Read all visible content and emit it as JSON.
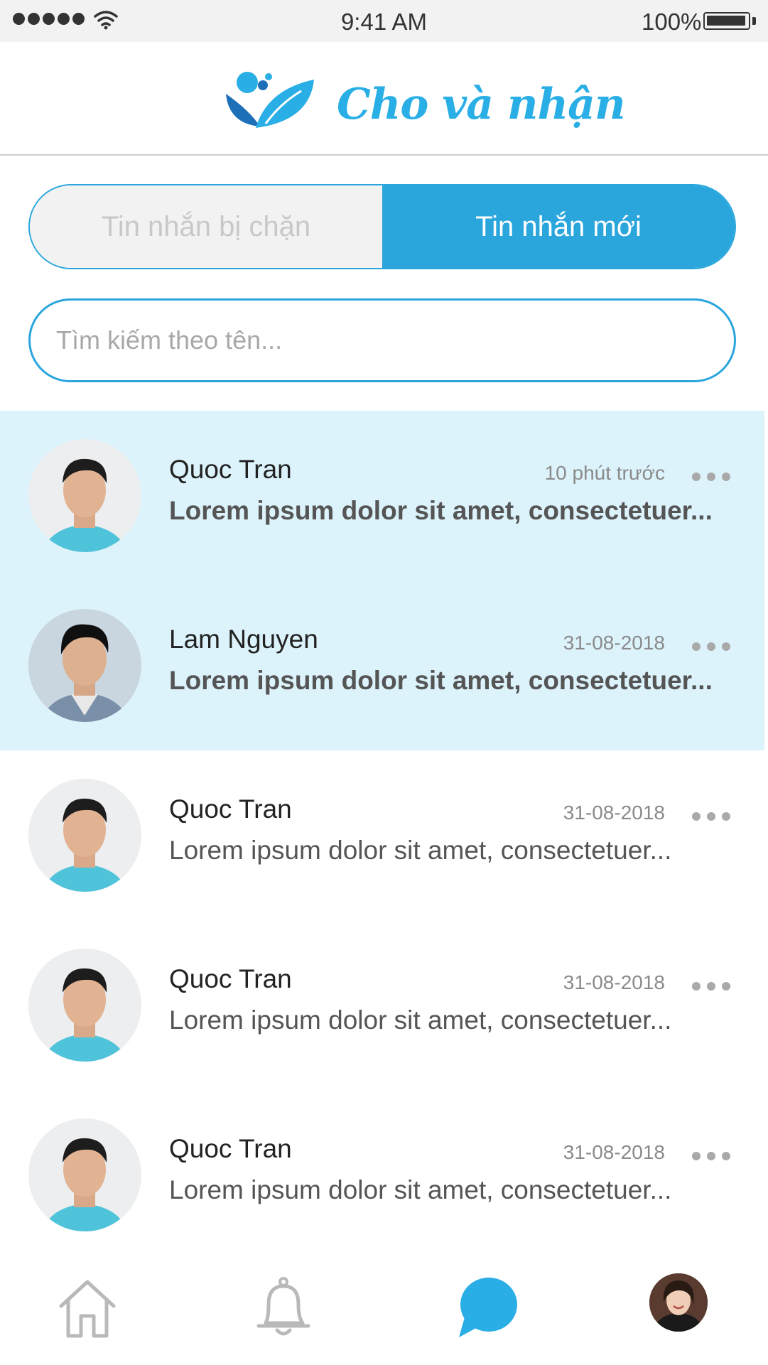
{
  "status_bar": {
    "time": "9:41 AM",
    "battery": "100%"
  },
  "header": {
    "app_name": "Cho và nhận"
  },
  "tabs": [
    {
      "label": "Tin nhắn bị chặn",
      "active": false
    },
    {
      "label": "Tin nhắn mới",
      "active": true
    }
  ],
  "search": {
    "placeholder": "Tìm kiếm theo tên..."
  },
  "messages": [
    {
      "name": "Quoc Tran",
      "time": "10 phút trước",
      "preview": "Lorem ipsum dolor sit amet, consectetuer...",
      "unread": true,
      "avatar": "young-man-avatar"
    },
    {
      "name": "Lam Nguyen",
      "time": "31-08-2018",
      "preview": "Lorem ipsum dolor sit amet, consectetuer...",
      "unread": true,
      "avatar": "young-man-avatar"
    },
    {
      "name": "Quoc Tran",
      "time": "31-08-2018",
      "preview": "Lorem ipsum dolor sit amet, consectetuer...",
      "unread": false,
      "avatar": "young-man-avatar"
    },
    {
      "name": "Quoc Tran",
      "time": "31-08-2018",
      "preview": "Lorem ipsum dolor sit amet, consectetuer...",
      "unread": false,
      "avatar": "young-man-avatar"
    },
    {
      "name": "Quoc Tran",
      "time": "31-08-2018",
      "preview": "Lorem ipsum dolor sit amet, consectetuer...",
      "unread": false,
      "avatar": "young-man-avatar"
    }
  ],
  "bottom_nav": [
    {
      "icon": "home-icon",
      "active": false
    },
    {
      "icon": "bell-icon",
      "active": false
    },
    {
      "icon": "chat-bubble-icon",
      "active": true
    },
    {
      "icon": "profile-avatar",
      "active": false
    }
  ],
  "colors": {
    "accent": "#2aa6dd",
    "highlight_row": "#dcf3fc",
    "logo": "#29aee6"
  }
}
